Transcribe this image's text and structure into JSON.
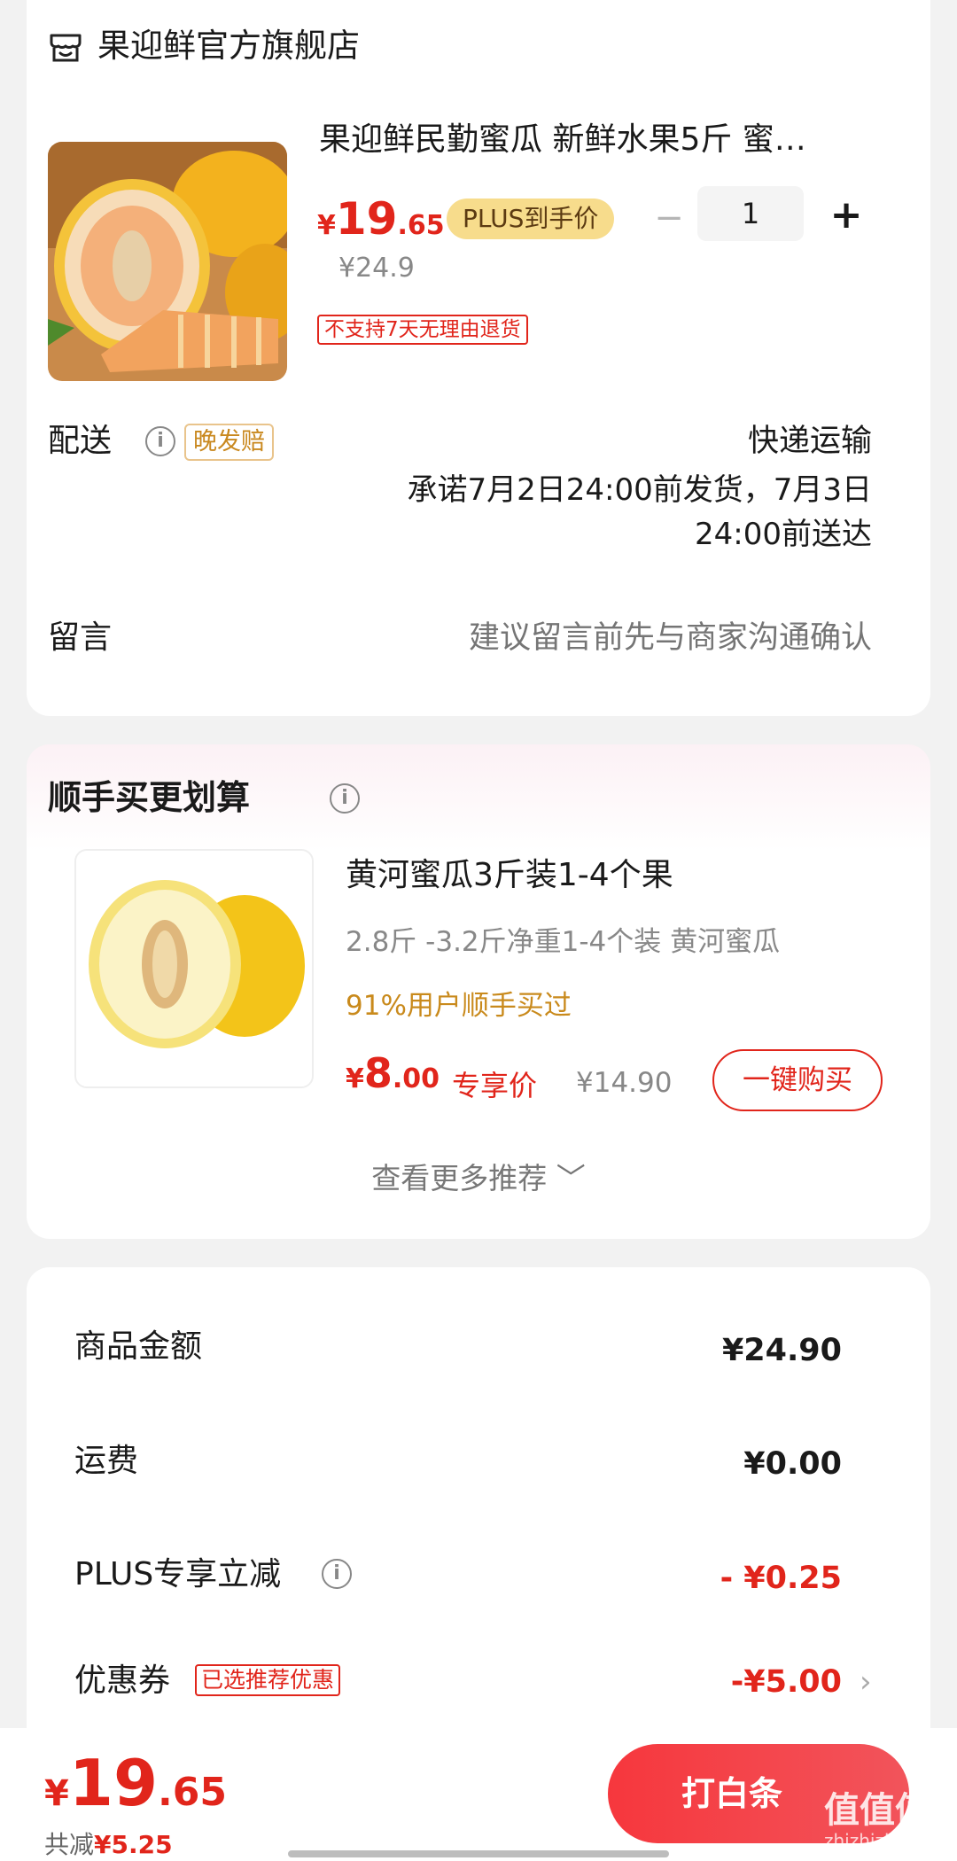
{
  "store": {
    "name": "果迎鲜官方旗舰店",
    "icon": "store-icon"
  },
  "product": {
    "title": "果迎鲜民勤蜜瓜 新鲜水果5斤 蜜…",
    "price_symbol": "¥",
    "price_int": "19",
    "price_dec": ".65",
    "plus_tag": "PLUS到手价",
    "original_price": "¥24.9",
    "return_policy": "不支持7天无理由退货",
    "quantity": "1",
    "minus": "−",
    "plus": "+"
  },
  "delivery": {
    "label": "配送",
    "late_tag": "晚发赔",
    "method": "快递运输",
    "promise": "承诺7月2日24:00前发货，7月3日24:00前送达"
  },
  "message": {
    "label": "留言",
    "placeholder": "建议留言前先与商家沟通确认"
  },
  "recommend": {
    "title": "顺手买更划算",
    "item": {
      "title": "黄河蜜瓜3斤装1-4个果",
      "spec": "2.8斤 -3.2斤净重1-4个装 黄河蜜瓜",
      "social": "91%用户顺手买过",
      "price_symbol": "¥",
      "price_int": "8",
      "price_dec": ".00",
      "price_tag": "专享价",
      "original_price": "¥14.90",
      "buy_label": "一键购买"
    },
    "more_label": "查看更多推荐"
  },
  "summary": {
    "goods_label": "商品金额",
    "goods_value": "¥24.90",
    "shipping_label": "运费",
    "shipping_value": "¥0.00",
    "plus_label": "PLUS专享立减",
    "plus_value": "- ¥0.25",
    "coupon_label": "优惠券",
    "coupon_tag": "已选推荐优惠",
    "coupon_value": "-¥5.00"
  },
  "bottom": {
    "price_symbol": "¥",
    "price_int": "19",
    "price_dec": ".65",
    "saved_label": "共减",
    "saved_value": "¥5.25",
    "pay_label": "打白条",
    "watermark": "值值值",
    "watermark_sub": "zhizhizhi.com"
  },
  "colors": {
    "accent": "#e1251b",
    "plus_gold": "#f7dc8c",
    "social_gold": "#c98a1c"
  }
}
